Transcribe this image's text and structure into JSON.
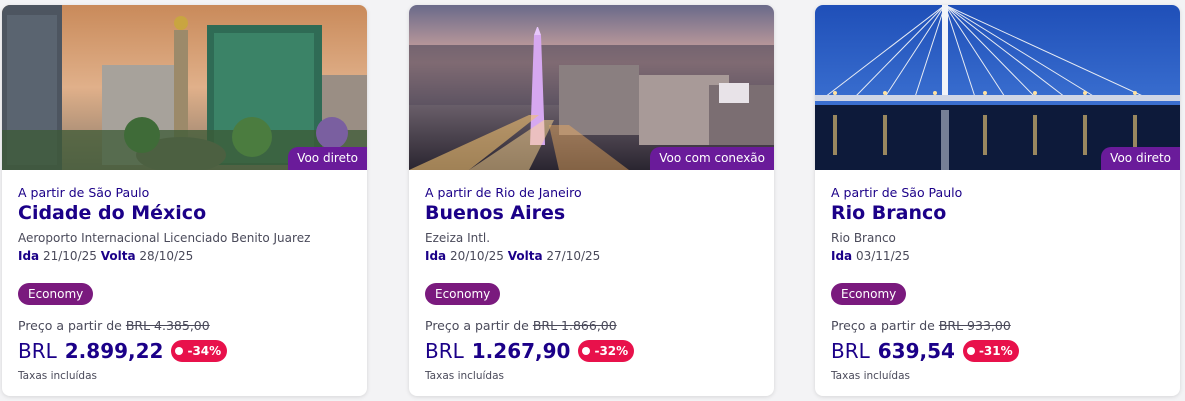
{
  "cards": [
    {
      "origin": "A partir de São Paulo",
      "city": "Cidade do México",
      "airport": "Aeroporto Internacional Licenciado Benito Juarez",
      "ida_label": "Ida",
      "ida_date": "21/10/25",
      "volta_label": "Volta",
      "volta_date": "28/10/25",
      "flight_type": "Voo direto",
      "cabin": "Economy",
      "price_from_label": "Preço a partir de",
      "old_price": "BRL 4.385,00",
      "currency": "BRL",
      "price": "2.899,22",
      "discount": "-34%",
      "taxes": "Taxas incluídas"
    },
    {
      "origin": "A partir de Rio de Janeiro",
      "city": "Buenos Aires",
      "airport": "Ezeiza Intl.",
      "ida_label": "Ida",
      "ida_date": "20/10/25",
      "volta_label": "Volta",
      "volta_date": "27/10/25",
      "flight_type": "Voo com conexão",
      "cabin": "Economy",
      "price_from_label": "Preço a partir de",
      "old_price": "BRL 1.866,00",
      "currency": "BRL",
      "price": "1.267,90",
      "discount": "-32%",
      "taxes": "Taxas incluídas"
    },
    {
      "origin": "A partir de São Paulo",
      "city": "Rio Branco",
      "airport": "Rio Branco",
      "ida_label": "Ida",
      "ida_date": "03/11/25",
      "flight_type": "Voo direto",
      "cabin": "Economy",
      "price_from_label": "Preço a partir de",
      "old_price": "BRL 933,00",
      "currency": "BRL",
      "price": "639,54",
      "discount": "-31%",
      "taxes": "Taxas incluídas"
    }
  ],
  "colors": {
    "brand_navy": "#1b0088",
    "flight_tag": "#6a1b9a",
    "cabin_pill": "#7a1a7e",
    "discount": "#e8114b"
  }
}
